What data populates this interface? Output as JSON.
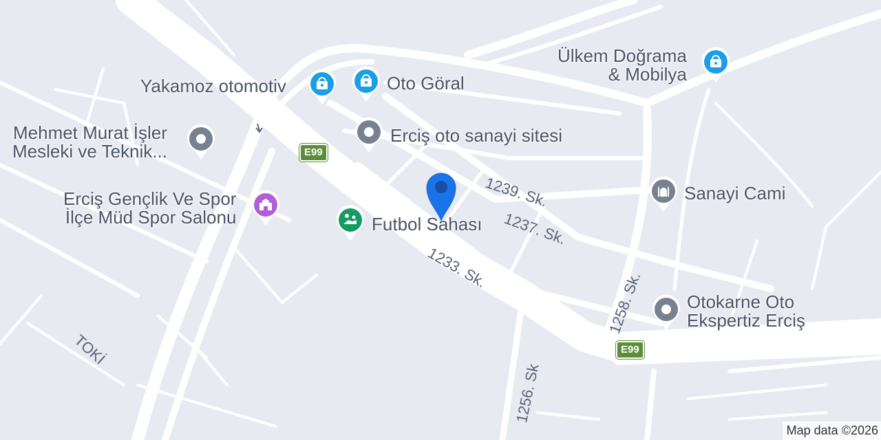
{
  "map": {
    "land_color": "#e8eaf2",
    "road_color": "#ffffff",
    "attribution": "Map data ©2026"
  },
  "streets": [
    {
      "name": "1239. Sk."
    },
    {
      "name": "1237. Sk."
    },
    {
      "name": "1233. Sk."
    },
    {
      "name": "1258. Sk."
    },
    {
      "name": "1256. Sk"
    },
    {
      "name": "TOKİ"
    }
  ],
  "highway_shields": [
    {
      "label": "E99"
    },
    {
      "label": "E99"
    }
  ],
  "pois": [
    {
      "name": "Yakamoz otomotiv",
      "icon": "shopping-bag-icon",
      "color": "#1a9ee6"
    },
    {
      "name": "Oto Göral",
      "icon": "shopping-bag-icon",
      "color": "#1a9ee6"
    },
    {
      "name": "Ülkem Doğrama\n& Mobilya",
      "icon": "shopping-bag-icon",
      "color": "#1a9ee6"
    },
    {
      "name": "Mehmet Murat İşler\nMesleki ve Teknik...",
      "icon": "place-icon",
      "color": "#78818f"
    },
    {
      "name": "Erciş oto sanayi sitesi",
      "icon": "place-icon",
      "color": "#78818f"
    },
    {
      "name": "Erciş Gençlik Ve Spor\nİlçe Müd Spor Salonu",
      "icon": "stadium-icon",
      "color": "#b05fd6"
    },
    {
      "name": "Futbol Sahası",
      "icon": "soccer-field-icon",
      "color": "#159c62"
    },
    {
      "name": "Sanayi Cami",
      "icon": "mosque-icon",
      "color": "#78818f"
    },
    {
      "name": "Otokarne Oto\nEkspertiz Erciş",
      "icon": "place-icon",
      "color": "#78818f"
    }
  ],
  "location_marker": {
    "icon": "location-pin-icon",
    "color": "#1a73e8"
  }
}
